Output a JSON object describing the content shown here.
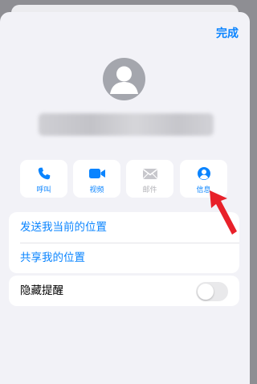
{
  "header": {
    "done_label": "完成"
  },
  "contact": {
    "avatar_icon": "person-silhouette-icon"
  },
  "actions": [
    {
      "label": "呼叫",
      "icon": "phone-icon",
      "enabled": true
    },
    {
      "label": "视频",
      "icon": "video-camera-icon",
      "enabled": true
    },
    {
      "label": "邮件",
      "icon": "mail-icon",
      "enabled": false
    },
    {
      "label": "信息",
      "icon": "person-circle-icon",
      "enabled": true
    }
  ],
  "location_group": {
    "items": [
      {
        "label": "发送我当前的位置"
      },
      {
        "label": "共享我的位置"
      }
    ]
  },
  "alerts": {
    "hide_alerts_label": "隐藏提醒",
    "hide_alerts_on": false
  },
  "colors": {
    "accent": "#0a84ff",
    "disabled": "#b4b4b9",
    "annotation_arrow": "#e8212a"
  }
}
